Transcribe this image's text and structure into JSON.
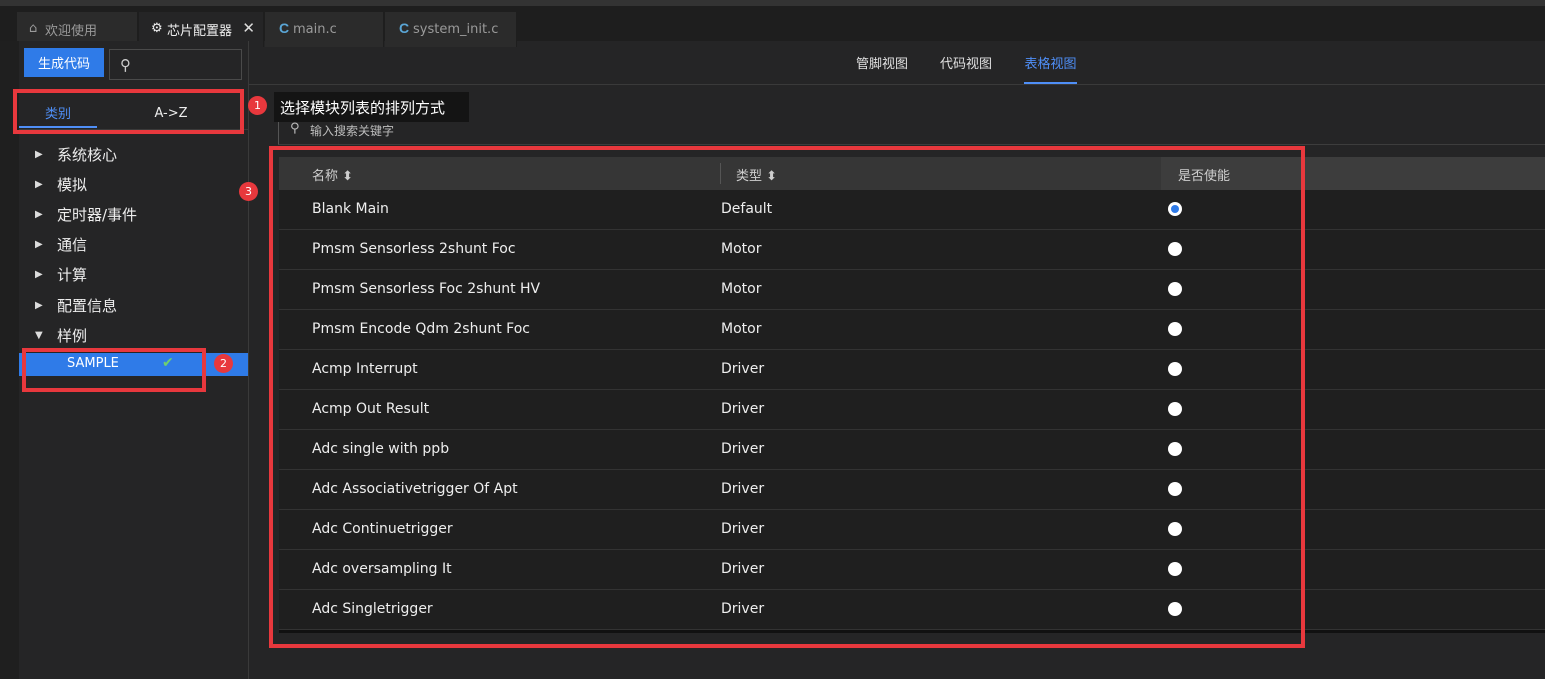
{
  "tabs": [
    {
      "label": "欢迎使用",
      "icon": "home-icon"
    },
    {
      "label": "芯片配置器",
      "icon": "chip-icon",
      "close": "✕"
    },
    {
      "label": "main.c",
      "icon": "c-file-icon",
      "icon_glyph": "C"
    },
    {
      "label": "system_init.c",
      "icon": "c-file-icon",
      "icon_glyph": "C"
    }
  ],
  "left": {
    "generate_label": "生成代码",
    "sort_tabs": [
      "类别",
      "A->Z"
    ],
    "tree": [
      {
        "label": "系统核心",
        "arrow": "▶"
      },
      {
        "label": "模拟",
        "arrow": "▶"
      },
      {
        "label": "定时器/事件",
        "arrow": "▶"
      },
      {
        "label": "通信",
        "arrow": "▶"
      },
      {
        "label": "计算",
        "arrow": "▶"
      },
      {
        "label": "配置信息",
        "arrow": "▶"
      },
      {
        "label": "样例",
        "arrow": "▼"
      }
    ],
    "selected_item": "SAMPLE"
  },
  "views": {
    "tabs": [
      "管脚视图",
      "代码视图",
      "表格视图"
    ],
    "active": "表格视图"
  },
  "tooltip": "选择模块列表的排列方式",
  "search_placeholder": "输入搜索关键字",
  "table": {
    "headers": [
      "名称",
      "类型",
      "是否使能"
    ],
    "sort_glyph": "⬍",
    "rows": [
      {
        "name": "Blank Main",
        "type": "Default",
        "enabled": true
      },
      {
        "name": "Pmsm Sensorless 2shunt Foc",
        "type": "Motor",
        "enabled": false
      },
      {
        "name": "Pmsm Sensorless Foc 2shunt HV",
        "type": "Motor",
        "enabled": false
      },
      {
        "name": "Pmsm Encode Qdm 2shunt Foc",
        "type": "Motor",
        "enabled": false
      },
      {
        "name": "Acmp Interrupt",
        "type": "Driver",
        "enabled": false
      },
      {
        "name": "Acmp Out Result",
        "type": "Driver",
        "enabled": false
      },
      {
        "name": "Adc single with ppb",
        "type": "Driver",
        "enabled": false
      },
      {
        "name": "Adc Associativetrigger Of Apt",
        "type": "Driver",
        "enabled": false
      },
      {
        "name": "Adc Continuetrigger",
        "type": "Driver",
        "enabled": false
      },
      {
        "name": "Adc oversampling It",
        "type": "Driver",
        "enabled": false
      },
      {
        "name": "Adc Singletrigger",
        "type": "Driver",
        "enabled": false
      }
    ]
  },
  "annotations": [
    "1",
    "2",
    "3"
  ],
  "colors": {
    "accent": "#2f7be8",
    "annotation": "#e8383d",
    "check": "#6fd06f"
  }
}
